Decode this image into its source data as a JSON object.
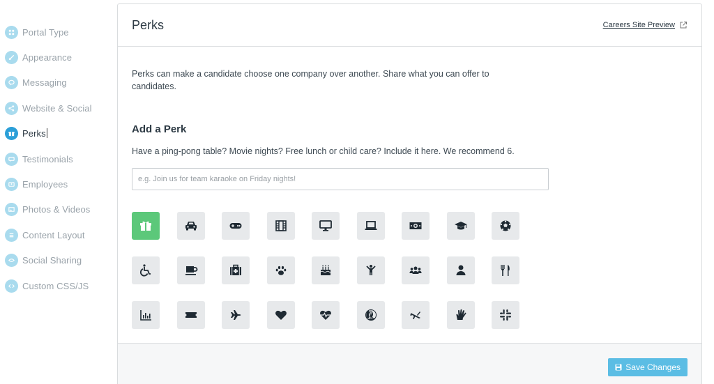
{
  "sidebar": {
    "items": [
      {
        "label": "Portal Type",
        "icon": "grid-icon"
      },
      {
        "label": "Appearance",
        "icon": "brush-icon"
      },
      {
        "label": "Messaging",
        "icon": "chat-icon"
      },
      {
        "label": "Website & Social",
        "icon": "share-icon"
      },
      {
        "label": "Perks",
        "icon": "gift-icon",
        "active": true
      },
      {
        "label": "Testimonials",
        "icon": "quote-icon"
      },
      {
        "label": "Employees",
        "icon": "people-icon"
      },
      {
        "label": "Photos & Videos",
        "icon": "image-icon"
      },
      {
        "label": "Content Layout",
        "icon": "layout-icon"
      },
      {
        "label": "Social Sharing",
        "icon": "share-alt-icon"
      },
      {
        "label": "Custom CSS/JS",
        "icon": "code-icon"
      }
    ]
  },
  "panel": {
    "title": "Perks",
    "preview_link": "Careers Site Preview",
    "intro": "Perks can make a candidate choose one company over another. Share what you can offer to candidates.",
    "add_title": "Add a Perk",
    "hint": "Have a ping-pong table? Movie nights? Free lunch or child care? Include it here. We recommend 6.",
    "input_placeholder": "e.g. Join us for team karaoke on Friday nights!",
    "input_value": "",
    "save_label": "Save Changes"
  },
  "perk_icons": [
    "gift-icon",
    "car-icon",
    "gamepad-icon",
    "film-icon",
    "desktop-icon",
    "laptop-icon",
    "money-icon",
    "graduation-cap-icon",
    "soccer-ball-icon",
    "wheelchair-icon",
    "coffee-icon",
    "medkit-icon",
    "paw-icon",
    "birthday-cake-icon",
    "child-icon",
    "users-icon",
    "user-icon",
    "cutlery-icon",
    "bar-chart-icon",
    "ticket-icon",
    "plane-icon",
    "heart-icon",
    "heartbeat-icon",
    "rebel-icon",
    "fighter-jet-icon",
    "hand-spock-icon",
    "slack-icon"
  ],
  "selected_perk": "gift-icon",
  "colors": {
    "accent": "#5bbde4",
    "active_nav": "#2b9fd8",
    "selected_icon": "#5cc87a",
    "icon_bg": "#e7e9eb"
  }
}
